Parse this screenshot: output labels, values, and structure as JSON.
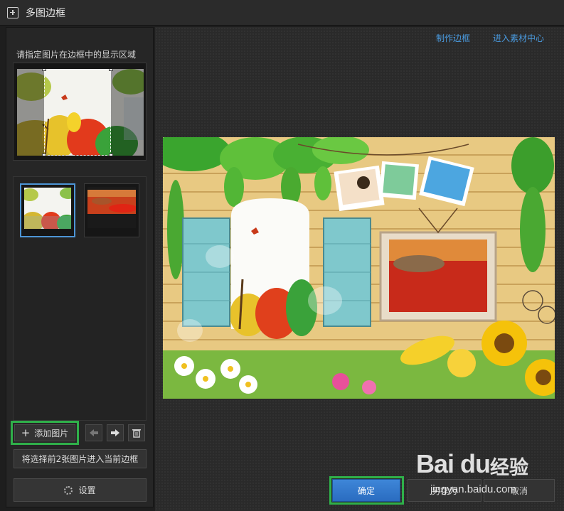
{
  "window": {
    "title": "多图边框"
  },
  "left": {
    "hint": "请指定图片在边框中的显示区域",
    "add_button": "添加图片",
    "apply_button": "将选择前2张图片进入当前边框",
    "settings_button": "设置"
  },
  "toolbar": {
    "make_frame_link": "制作边框",
    "material_center_link": "进入素材中心"
  },
  "footer": {
    "ok_button": "确定",
    "save_as_button": "另存为",
    "cancel_button": "取消"
  },
  "watermark": {
    "logo": "Bai du",
    "brand": "经验",
    "url": "jingyan.baidu.com"
  },
  "colors": {
    "accent": "#4a9be0",
    "highlight": "#2fb04a",
    "primary_button": "#3e86d8"
  }
}
